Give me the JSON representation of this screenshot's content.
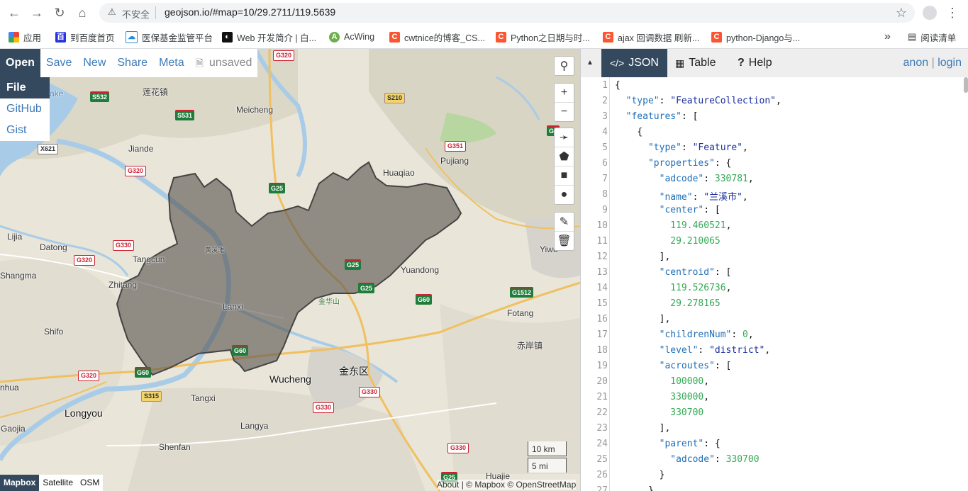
{
  "browser": {
    "insecure_label": "不安全",
    "url": "geojson.io/#map=10/29.2711/119.5639",
    "bookmarks": [
      {
        "icon": "apps-icon",
        "label": "应用"
      },
      {
        "icon": "baidu-icon",
        "label": "到百度首页"
      },
      {
        "icon": "cloud-icon",
        "label": "医保基金监管平台"
      },
      {
        "icon": "mdn-icon",
        "label": "Web 开发简介 | 白..."
      },
      {
        "icon": "acwing-icon",
        "label": "AcWing"
      },
      {
        "icon": "csdn-icon",
        "label": "cwtnice的博客_CS..."
      },
      {
        "icon": "csdn-icon",
        "label": "Python之日期与时..."
      },
      {
        "icon": "csdn-icon",
        "label": "ajax 回调数据 刷新..."
      },
      {
        "icon": "csdn-icon",
        "label": "python-Django与..."
      }
    ],
    "more": "»",
    "reading_list": "阅读清单"
  },
  "toolbar": {
    "open": "Open",
    "save": "Save",
    "new": "New",
    "share": "Share",
    "meta": "Meta",
    "unsaved": "unsaved"
  },
  "open_menu": {
    "file": "File",
    "github": "GitHub",
    "gist": "Gist"
  },
  "map": {
    "labels": [
      "莲花镇",
      "Meicheng",
      "Jiande",
      "Huaqiao",
      "Pujiang",
      "Lijia",
      "Datong",
      "Tangcun",
      "Shangma",
      "Zhitang",
      "Shifo",
      "Lanxi",
      "黄溪滩",
      "金华山",
      "Yuandong",
      "Yiwu",
      "Fotang",
      "赤岸镇",
      "Wucheng",
      "金东区",
      "Longyou",
      "Tangxi",
      "Langya",
      "Gaojia",
      "Shenfan",
      "Huajie",
      "nhua",
      "ake"
    ],
    "shields": [
      "G320",
      "S532",
      "S531",
      "S210",
      "G351",
      "G25",
      "X621",
      "G320",
      "G330",
      "G320",
      "G25",
      "G25",
      "G60",
      "G1512",
      "G60",
      "G60",
      "G320",
      "S315",
      "G330",
      "G330",
      "G330",
      "G25",
      "G6"
    ],
    "scale_km": "10 km",
    "scale_mi": "5 mi",
    "layers": [
      "Mapbox",
      "Satellite",
      "OSM"
    ],
    "attribution": "About | © Mapbox © OpenStreetMap"
  },
  "panel": {
    "tabs": [
      {
        "label": "JSON",
        "icon": "code-icon"
      },
      {
        "label": "Table",
        "icon": "table-icon"
      },
      {
        "label": "Help",
        "icon": "help-icon"
      }
    ],
    "anon": "anon",
    "sep": "|",
    "login": "login"
  },
  "code_lines": [
    "{",
    "  \"type\": \"FeatureCollection\",",
    "  \"features\": [",
    "    {",
    "      \"type\": \"Feature\",",
    "      \"properties\": {",
    "        \"adcode\": 330781,",
    "        \"name\": \"兰溪市\",",
    "        \"center\": [",
    "          119.460521,",
    "          29.210065",
    "        ],",
    "        \"centroid\": [",
    "          119.526736,",
    "          29.278165",
    "        ],",
    "        \"childrenNum\": 0,",
    "        \"level\": \"district\",",
    "        \"acroutes\": [",
    "          100000,",
    "          330000,",
    "          330700",
    "        ],",
    "        \"parent\": {",
    "          \"adcode\": 330700",
    "        }",
    "      }"
  ],
  "line_numbers": [
    "1",
    "2",
    "3",
    "4",
    "5",
    "6",
    "7",
    "8",
    "9",
    "10",
    "11",
    "12",
    "13",
    "14",
    "15",
    "16",
    "17",
    "18",
    "19",
    "20",
    "21",
    "22",
    "23",
    "24",
    "25",
    "26",
    "27"
  ]
}
